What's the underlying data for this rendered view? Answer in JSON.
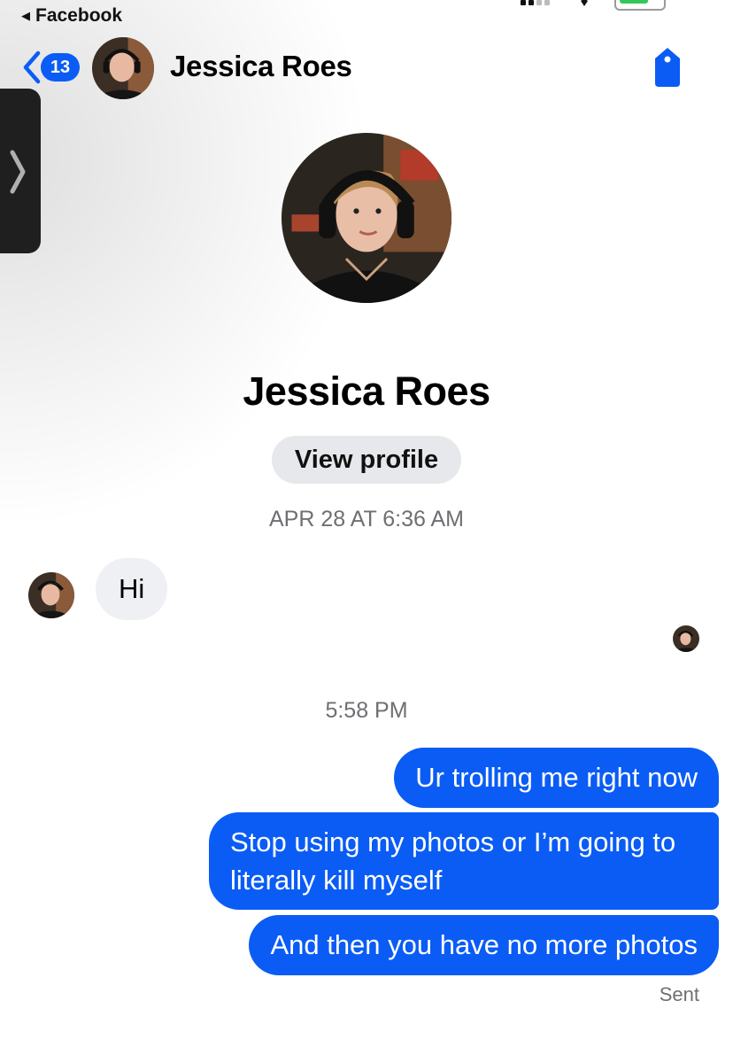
{
  "status_bar": {
    "back_app": "Facebook"
  },
  "header": {
    "unread_count": "13",
    "contact_name": "Jessica Roes"
  },
  "profile": {
    "name": "Jessica Roes",
    "view_profile_label": "View profile"
  },
  "timestamps": {
    "first": "APR 28 AT 6:36 AM",
    "second": "5:58 PM"
  },
  "messages": [
    {
      "from": "them",
      "text": "Hi"
    },
    {
      "from": "me",
      "text": "Ur trolling me right now"
    },
    {
      "from": "me",
      "text": "Stop using my photos or I’m going to literally kill myself"
    },
    {
      "from": "me",
      "text": "And then you have no more photos"
    }
  ],
  "delivery_status": "Sent",
  "icons": {
    "back": "chevron-left-icon",
    "tag": "tag-icon",
    "side": "chevron-right-icon"
  },
  "colors": {
    "accent": "#0a5cf5",
    "incoming_bubble": "#eef0f3",
    "button_bg": "#e6e8eb",
    "timestamp": "#6f6f73"
  }
}
